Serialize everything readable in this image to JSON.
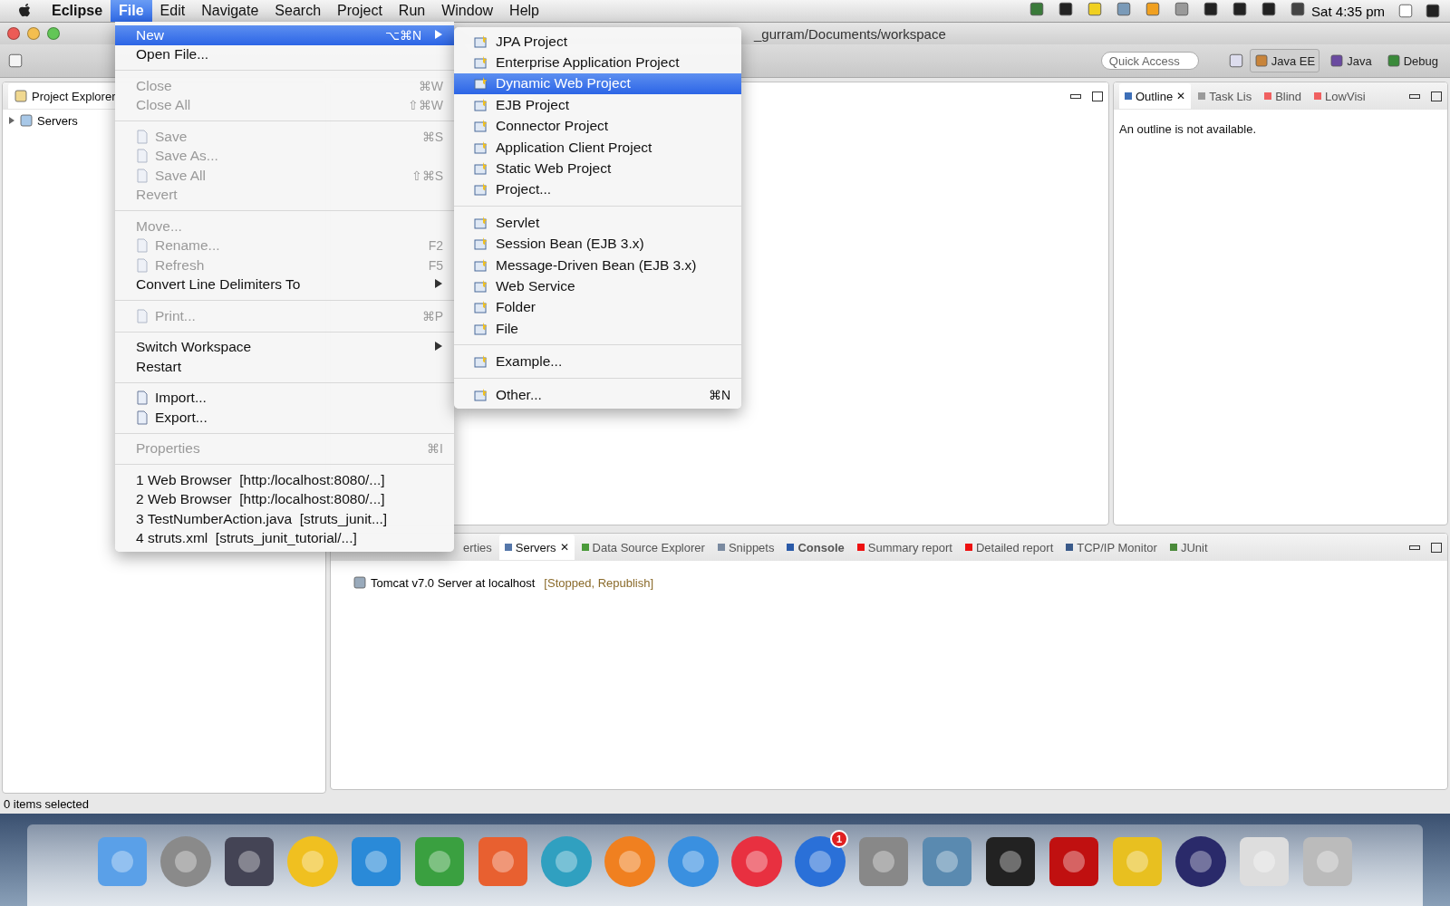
{
  "menu_bar": {
    "app": "Eclipse",
    "menus": [
      {
        "label": "File",
        "selected": true
      },
      {
        "label": "Edit",
        "selected": false
      },
      {
        "label": "Navigate",
        "selected": false
      },
      {
        "label": "Search",
        "selected": false
      },
      {
        "label": "Project",
        "selected": false
      },
      {
        "label": "Run",
        "selected": false
      },
      {
        "label": "Window",
        "selected": false
      },
      {
        "label": "Help",
        "selected": false
      }
    ],
    "clock": "Sat 4:35 pm"
  },
  "window": {
    "title": "_gurram/Documents/workspace"
  },
  "toolbar": {
    "quick_access": {
      "placeholder": "Quick Access"
    },
    "perspectives": [
      {
        "label": "Java EE",
        "selected": true
      },
      {
        "label": "Java",
        "selected": false
      },
      {
        "label": "Debug",
        "selected": false
      }
    ]
  },
  "project_explorer": {
    "title": "Project Explorer",
    "tree": [
      {
        "label": "Servers",
        "expanded": false
      }
    ]
  },
  "outline": {
    "tabs": [
      {
        "label": "Outline",
        "selected": true,
        "close": "✕",
        "color": "#3d6fb8"
      },
      {
        "label": "Task Lis",
        "selected": false,
        "color": "#9a9a9a"
      },
      {
        "label": "Blind",
        "selected": false,
        "color": "#f06060"
      },
      {
        "label": "LowVisi",
        "selected": false,
        "color": "#f06060"
      }
    ],
    "message": "An outline is not available."
  },
  "bottom_panel": {
    "tabs": [
      {
        "label": "erties",
        "selected": false,
        "bold": false
      },
      {
        "label": "Servers",
        "selected": true,
        "close": "✕",
        "bold": false,
        "color": "#5577aa"
      },
      {
        "label": "Data Source Explorer",
        "selected": false,
        "bold": false,
        "color": "#4a9a3a"
      },
      {
        "label": "Snippets",
        "selected": false,
        "bold": false,
        "color": "#7a8aa0"
      },
      {
        "label": "Console",
        "selected": false,
        "bold": true,
        "color": "#2a5aa8"
      },
      {
        "label": "Summary report",
        "selected": false,
        "bold": false,
        "color": "#ee1111"
      },
      {
        "label": "Detailed report",
        "selected": false,
        "bold": false,
        "color": "#ee1111"
      },
      {
        "label": "TCP/IP Monitor",
        "selected": false,
        "bold": false,
        "color": "#3a5a8a"
      },
      {
        "label": "JUnit",
        "selected": false,
        "bold": false,
        "color": "#4a8a3a"
      }
    ],
    "servers": [
      {
        "name": "Tomcat v7.0 Server at localhost",
        "status": "[Stopped, Republish]"
      }
    ]
  },
  "status_bar": {
    "text": "0 items selected"
  },
  "file_menu": [
    {
      "kind": "item",
      "label": "New",
      "shortcut": "⌥⌘N",
      "submenu": true,
      "disabled": false,
      "selected": true,
      "icon": false
    },
    {
      "kind": "item",
      "label": "Open File...",
      "submenu": false,
      "disabled": false,
      "selected": false,
      "icon": false
    },
    {
      "kind": "separator"
    },
    {
      "kind": "item",
      "label": "Close",
      "shortcut": "⌘W",
      "submenu": false,
      "disabled": true,
      "selected": false,
      "icon": false
    },
    {
      "kind": "item",
      "label": "Close All",
      "shortcut": "⇧⌘W",
      "submenu": false,
      "disabled": true,
      "selected": false,
      "icon": false
    },
    {
      "kind": "separator"
    },
    {
      "kind": "item",
      "label": "Save",
      "shortcut": "⌘S",
      "submenu": false,
      "disabled": true,
      "selected": false,
      "icon": true
    },
    {
      "kind": "item",
      "label": "Save As...",
      "submenu": false,
      "disabled": true,
      "selected": false,
      "icon": true
    },
    {
      "kind": "item",
      "label": "Save All",
      "shortcut": "⇧⌘S",
      "submenu": false,
      "disabled": true,
      "selected": false,
      "icon": true
    },
    {
      "kind": "item",
      "label": "Revert",
      "submenu": false,
      "disabled": true,
      "selected": false,
      "icon": false
    },
    {
      "kind": "separator"
    },
    {
      "kind": "item",
      "label": "Move...",
      "submenu": false,
      "disabled": true,
      "selected": false,
      "icon": false
    },
    {
      "kind": "item",
      "label": "Rename...",
      "shortcut": "F2",
      "submenu": false,
      "disabled": true,
      "selected": false,
      "icon": true
    },
    {
      "kind": "item",
      "label": "Refresh",
      "shortcut": "F5",
      "submenu": false,
      "disabled": true,
      "selected": false,
      "icon": true
    },
    {
      "kind": "item",
      "label": "Convert Line Delimiters To",
      "submenu": true,
      "disabled": false,
      "selected": false,
      "icon": false
    },
    {
      "kind": "separator"
    },
    {
      "kind": "item",
      "label": "Print...",
      "shortcut": "⌘P",
      "submenu": false,
      "disabled": true,
      "selected": false,
      "icon": true
    },
    {
      "kind": "separator"
    },
    {
      "kind": "item",
      "label": "Switch Workspace",
      "submenu": true,
      "disabled": false,
      "selected": false,
      "icon": false
    },
    {
      "kind": "item",
      "label": "Restart",
      "submenu": false,
      "disabled": false,
      "selected": false,
      "icon": false
    },
    {
      "kind": "separator"
    },
    {
      "kind": "item",
      "label": "Import...",
      "submenu": false,
      "disabled": false,
      "selected": false,
      "icon": true
    },
    {
      "kind": "item",
      "label": "Export...",
      "submenu": false,
      "disabled": false,
      "selected": false,
      "icon": true
    },
    {
      "kind": "separator"
    },
    {
      "kind": "item",
      "label": "Properties",
      "shortcut": "⌘I",
      "submenu": false,
      "disabled": true,
      "selected": false,
      "icon": false
    },
    {
      "kind": "separator"
    },
    {
      "kind": "item",
      "label": "1 Web Browser  [http:/localhost:8080/...]",
      "submenu": false,
      "disabled": false,
      "selected": false,
      "icon": false
    },
    {
      "kind": "item",
      "label": "2 Web Browser  [http:/localhost:8080/...]",
      "submenu": false,
      "disabled": false,
      "selected": false,
      "icon": false
    },
    {
      "kind": "item",
      "label": "3 TestNumberAction.java  [struts_junit...]",
      "submenu": false,
      "disabled": false,
      "selected": false,
      "icon": false
    },
    {
      "kind": "item",
      "label": "4 struts.xml  [struts_junit_tutorial/...]",
      "submenu": false,
      "disabled": false,
      "selected": false,
      "icon": false
    }
  ],
  "new_submenu": [
    {
      "kind": "item",
      "label": "JPA Project",
      "selected": false
    },
    {
      "kind": "item",
      "label": "Enterprise Application Project",
      "selected": false
    },
    {
      "kind": "item",
      "label": "Dynamic Web Project",
      "selected": true
    },
    {
      "kind": "item",
      "label": "EJB Project",
      "selected": false
    },
    {
      "kind": "item",
      "label": "Connector Project",
      "selected": false
    },
    {
      "kind": "item",
      "label": "Application Client Project",
      "selected": false
    },
    {
      "kind": "item",
      "label": "Static Web Project",
      "selected": false
    },
    {
      "kind": "item",
      "label": "Project...",
      "selected": false
    },
    {
      "kind": "separator"
    },
    {
      "kind": "item",
      "label": "Servlet",
      "selected": false
    },
    {
      "kind": "item",
      "label": "Session Bean (EJB 3.x)",
      "selected": false
    },
    {
      "kind": "item",
      "label": "Message-Driven Bean (EJB 3.x)",
      "selected": false
    },
    {
      "kind": "item",
      "label": "Web Service",
      "selected": false
    },
    {
      "kind": "item",
      "label": "Folder",
      "selected": false
    },
    {
      "kind": "item",
      "label": "File",
      "selected": false
    },
    {
      "kind": "separator"
    },
    {
      "kind": "item",
      "label": "Example...",
      "selected": false
    },
    {
      "kind": "separator"
    },
    {
      "kind": "item",
      "label": "Other...",
      "shortcut": "⌘N",
      "selected": false
    }
  ],
  "dock": {
    "badge": "1"
  }
}
